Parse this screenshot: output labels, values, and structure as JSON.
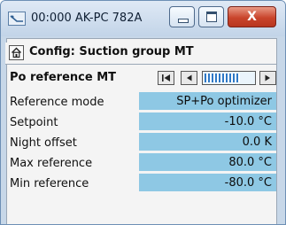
{
  "window": {
    "title": "00:000 AK-PC 782A",
    "close_glyph": "X",
    "icons": {
      "app": "controller-app-icon",
      "minimize": "minimize-icon",
      "maximize": "maximize-icon",
      "close": "close-icon"
    }
  },
  "header": {
    "title": "Config: Suction group MT",
    "home_icon": "home-icon"
  },
  "page": {
    "label": "Po reference MT",
    "navigator": {
      "first_icon": "first-page-icon",
      "prev_icon": "previous-page-icon",
      "next_icon": "next-page-icon",
      "position_fraction": 0.72
    }
  },
  "params": [
    {
      "label": "Reference mode",
      "value": "SP+Po optimizer"
    },
    {
      "label": "Setpoint",
      "value": "-10.0 °C"
    },
    {
      "label": "Night offset",
      "value": "0.0 K"
    },
    {
      "label": "Max reference",
      "value": "80.0 °C"
    },
    {
      "label": "Min reference",
      "value": "-80.0 °C"
    }
  ],
  "colors": {
    "value_background": "#8ec8e4",
    "close_button": "#c9452c",
    "navigator_bar": "#2f79c6"
  }
}
